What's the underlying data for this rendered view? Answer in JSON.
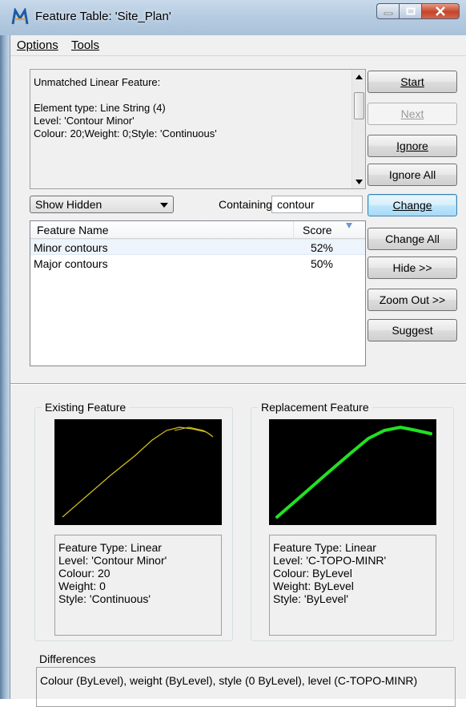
{
  "window": {
    "title": "Feature Table: 'Site_Plan'"
  },
  "menu": {
    "options": "Options",
    "tools": "Tools"
  },
  "info": {
    "lines": [
      "Unmatched Linear Feature:",
      "",
      "Element type: Line String (4)",
      "Level: 'Contour Minor'",
      "Colour: 20;Weight: 0;Style: 'Continuous'"
    ]
  },
  "buttons": {
    "start": "Start",
    "next": "Next",
    "ignore": "Ignore",
    "ignore_all": "Ignore All",
    "change": "Change",
    "change_all": "Change All",
    "hide": "Hide >>",
    "zoom_out": "Zoom Out >>",
    "suggest": "Suggest"
  },
  "filter": {
    "show_option": "Show Hidden",
    "containing_label": "Containing:",
    "containing_value": "contour"
  },
  "list": {
    "columns": [
      "Feature Name",
      "Score"
    ],
    "rows": [
      {
        "name": "Minor contours",
        "score": "52%"
      },
      {
        "name": "Major contours",
        "score": "50%"
      }
    ]
  },
  "existing": {
    "label": "Existing Feature",
    "props": [
      "Feature Type: Linear",
      "Level: 'Contour Minor'",
      "Colour: 20",
      "Weight: 0",
      "Style: 'Continuous'"
    ],
    "line_color": "#d4c21a"
  },
  "replacement": {
    "label": "Replacement Feature",
    "props": [
      "Feature Type: Linear",
      "Level: 'C-TOPO-MINR'",
      "Colour: ByLevel",
      "Weight: ByLevel",
      "Style: 'ByLevel'"
    ],
    "line_color": "#22e022"
  },
  "differences": {
    "label": "Differences",
    "text": "Colour (ByLevel), weight (ByLevel), style (0  ByLevel), level (C-TOPO-MINR)"
  },
  "colors": {
    "accent": "#3c7fb1",
    "selected_row": "#edf4fb",
    "close_button": "#c4452a"
  }
}
